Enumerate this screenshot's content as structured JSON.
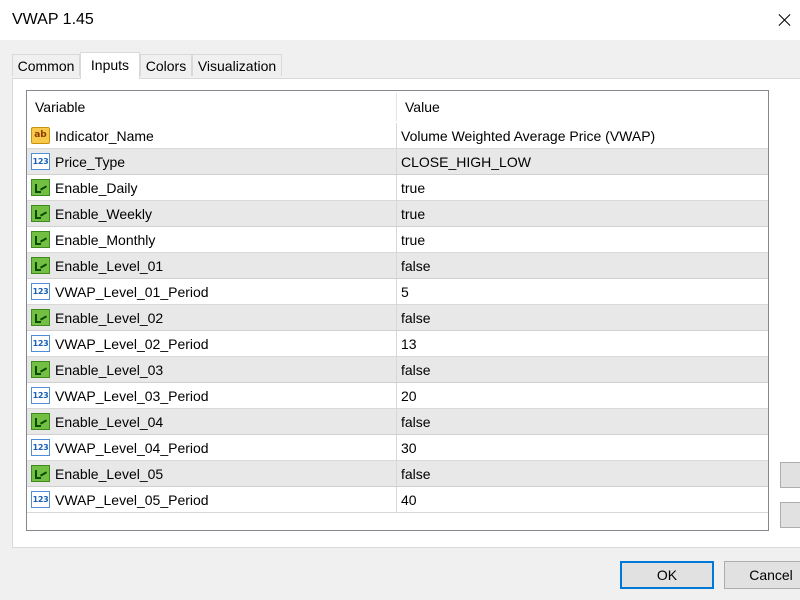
{
  "window": {
    "title": "VWAP 1.45"
  },
  "tabs": [
    "Common",
    "Inputs",
    "Colors",
    "Visualization"
  ],
  "active_tab": "Inputs",
  "grid": {
    "columns": [
      "Variable",
      "Value"
    ],
    "rows": [
      {
        "icon": "string-type-icon",
        "icon_text": "ab",
        "variable": "Indicator_Name",
        "value": "Volume Weighted Average Price (VWAP)"
      },
      {
        "icon": "numeric-type-icon",
        "icon_text": "123",
        "variable": "Price_Type",
        "value": "CLOSE_HIGH_LOW"
      },
      {
        "icon": "boolean-type-icon",
        "icon_text": "",
        "variable": "Enable_Daily",
        "value": "true"
      },
      {
        "icon": "boolean-type-icon",
        "icon_text": "",
        "variable": "Enable_Weekly",
        "value": "true"
      },
      {
        "icon": "boolean-type-icon",
        "icon_text": "",
        "variable": "Enable_Monthly",
        "value": "true"
      },
      {
        "icon": "boolean-type-icon",
        "icon_text": "",
        "variable": "Enable_Level_01",
        "value": "false"
      },
      {
        "icon": "numeric-type-icon",
        "icon_text": "123",
        "variable": "VWAP_Level_01_Period",
        "value": "5"
      },
      {
        "icon": "boolean-type-icon",
        "icon_text": "",
        "variable": "Enable_Level_02",
        "value": "false"
      },
      {
        "icon": "numeric-type-icon",
        "icon_text": "123",
        "variable": "VWAP_Level_02_Period",
        "value": "13"
      },
      {
        "icon": "boolean-type-icon",
        "icon_text": "",
        "variable": "Enable_Level_03",
        "value": "false"
      },
      {
        "icon": "numeric-type-icon",
        "icon_text": "123",
        "variable": "VWAP_Level_03_Period",
        "value": "20"
      },
      {
        "icon": "boolean-type-icon",
        "icon_text": "",
        "variable": "Enable_Level_04",
        "value": "false"
      },
      {
        "icon": "numeric-type-icon",
        "icon_text": "123",
        "variable": "VWAP_Level_04_Period",
        "value": "30"
      },
      {
        "icon": "boolean-type-icon",
        "icon_text": "",
        "variable": "Enable_Level_05",
        "value": "false"
      },
      {
        "icon": "numeric-type-icon",
        "icon_text": "123",
        "variable": "VWAP_Level_05_Period",
        "value": "40"
      }
    ]
  },
  "buttons": {
    "ok": "OK",
    "cancel": "Cancel"
  },
  "colors": {
    "focus_accent": "#0078d7",
    "dialog_bg": "#f0f0f0",
    "row_alt": "#e8e8e8"
  }
}
